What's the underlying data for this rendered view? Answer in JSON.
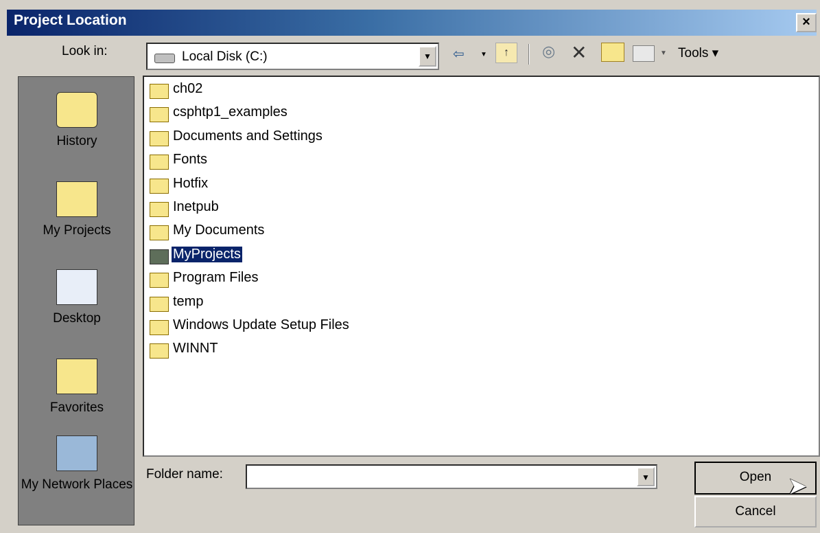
{
  "window": {
    "title": "Project Location",
    "close_label": "×"
  },
  "lookin": {
    "label": "Look in:",
    "value": "Local Disk (C:)"
  },
  "toolbar": {
    "tools_label": "Tools ▾"
  },
  "places": [
    {
      "label": "History",
      "icon": "history-icon"
    },
    {
      "label": "My Projects",
      "icon": "my-projects-icon"
    },
    {
      "label": "Desktop",
      "icon": "desktop-icon"
    },
    {
      "label": "Favorites",
      "icon": "favorites-icon"
    },
    {
      "label": "My Network Places",
      "icon": "network-places-icon"
    }
  ],
  "folders": [
    {
      "name": "ch02",
      "selected": false
    },
    {
      "name": "csphtp1_examples",
      "selected": false
    },
    {
      "name": "Documents and Settings",
      "selected": false
    },
    {
      "name": "Fonts",
      "selected": false
    },
    {
      "name": "Hotfix",
      "selected": false
    },
    {
      "name": "Inetpub",
      "selected": false
    },
    {
      "name": "My Documents",
      "selected": false
    },
    {
      "name": "MyProjects",
      "selected": true
    },
    {
      "name": "Program Files",
      "selected": false
    },
    {
      "name": "temp",
      "selected": false
    },
    {
      "name": "Windows Update Setup Files",
      "selected": false
    },
    {
      "name": "WINNT",
      "selected": false
    }
  ],
  "folder_name": {
    "label": "Folder name:",
    "value": ""
  },
  "buttons": {
    "open": "Open",
    "cancel": "Cancel"
  },
  "colors": {
    "titlebar_start": "#0a246a",
    "selection": "#0a246a",
    "face": "#d4d0c8"
  }
}
